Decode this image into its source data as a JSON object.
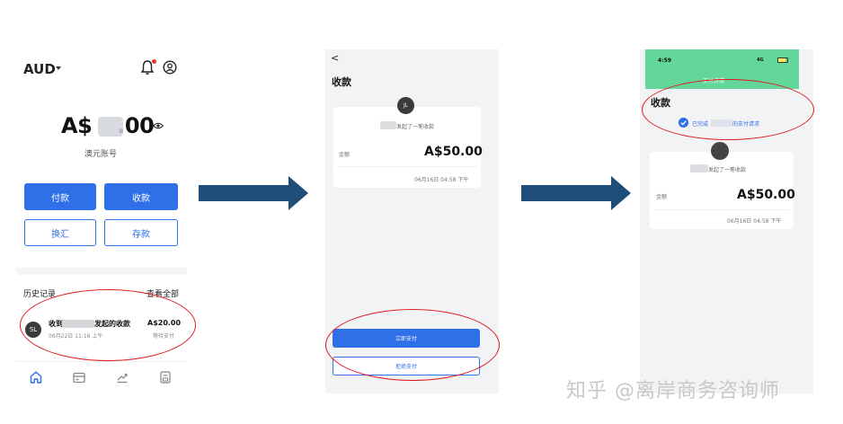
{
  "screen1": {
    "currency": "AUD",
    "balance": "A$ .00",
    "balance_prefix": "A$",
    "balance_suffix": ".00",
    "account_label": "澳元账号",
    "buttons": {
      "pay": "付款",
      "receive": "收款",
      "exchange": "换汇",
      "deposit": "存款"
    },
    "history": {
      "title": "历史记录",
      "view_all": "查看全部",
      "item": {
        "avatar": "SL",
        "title_prefix": "收到",
        "title_suffix": "发起的收款",
        "time": "06月22日 11:16 上午",
        "amount": "A$20.00",
        "status": "等待支付"
      }
    },
    "tabs": [
      "home-icon",
      "wallet-icon",
      "chart-icon",
      "document-icon"
    ]
  },
  "screen2": {
    "back": "<",
    "title": "收款",
    "avatar": "JL",
    "subtitle": "发起了一笔收款",
    "amount_label": "金额",
    "amount": "A$50.00",
    "time": "06月16日 04:58 下午",
    "pay_button": "立即支付",
    "refuse_button": "拒绝支付"
  },
  "screen3": {
    "status_time": "4:59",
    "signal": "4G",
    "header": "支付详情",
    "title": "收款",
    "done_prefix": "已完成",
    "done_suffix": "的支付请求",
    "subtitle": "发起了一笔收款",
    "amount_label": "金额",
    "amount": "A$50.00",
    "time": "06月16日 04:58 下午"
  },
  "watermark": "知乎 @离岸商务咨询师",
  "colors": {
    "accent": "#2f6fe8",
    "arrow": "#1f4e79",
    "highlight": "#e0191f",
    "status_bar": "#63d69a"
  }
}
